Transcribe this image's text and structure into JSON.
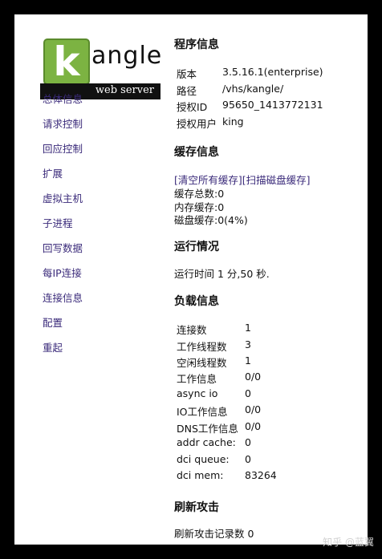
{
  "logo": {
    "k": "k",
    "word": "angle",
    "sub": "web server"
  },
  "nav": [
    "总体信息",
    "请求控制",
    "回应控制",
    "扩展",
    "虚拟主机",
    "子进程",
    "回写数据",
    "每IP连接",
    "连接信息",
    "配置",
    "重起"
  ],
  "program": {
    "title": "程序信息",
    "rows": [
      {
        "k": "版本",
        "v": "3.5.16.1(enterprise)"
      },
      {
        "k": "路径",
        "v": "/vhs/kangle/"
      },
      {
        "k": "授权ID",
        "v": "95650_1413772131"
      },
      {
        "k": "授权用户",
        "v": "king"
      }
    ]
  },
  "cache": {
    "title": "缓存信息",
    "clear_link": "[清空所有缓存]",
    "scan_link": "[扫描磁盘缓存]",
    "total": "缓存总数:0",
    "memory": "内存缓存:0",
    "disk": "磁盘缓存:0(4%)"
  },
  "running": {
    "title": "运行情况",
    "uptime": "运行时间 1 分,50 秒."
  },
  "load": {
    "title": "负载信息",
    "rows": [
      {
        "k": "连接数",
        "v": "1"
      },
      {
        "k": "工作线程数",
        "v": "3"
      },
      {
        "k": "空闲线程数",
        "v": "1"
      },
      {
        "k": "工作信息",
        "v": "0/0"
      },
      {
        "k": "async io",
        "v": "0"
      },
      {
        "k": "IO工作信息",
        "v": "0/0"
      },
      {
        "k": "DNS工作信息",
        "v": "0/0"
      },
      {
        "k": "addr cache:",
        "v": "0"
      },
      {
        "k": "dci queue:",
        "v": "0"
      },
      {
        "k": "dci mem:",
        "v": "83264"
      }
    ]
  },
  "flood": {
    "title": "刷新攻击",
    "records": "刷新攻击记录数 0"
  },
  "watermark": "知乎 @蓝翼"
}
